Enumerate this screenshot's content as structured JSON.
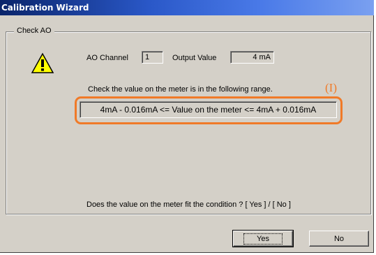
{
  "window": {
    "title": "Calibration Wizard"
  },
  "group": {
    "legend": "Check AO"
  },
  "icons": {
    "warning": "warning-triangle-icon"
  },
  "fields": {
    "ao_channel_label": "AO Channel",
    "ao_channel_value": "1",
    "output_value_label": "Output Value",
    "output_value_value": "4 mA"
  },
  "instruction": "Check the value on the meter is in the following range.",
  "range_text": "4mA - 0.016mA <=  Value on the meter  <= 4mA + 0.016mA",
  "annotation": {
    "marker": "(I)",
    "color": "#f07a28"
  },
  "question": "Does the value on the meter fit the condition ?  [ Yes ] / [ No ]",
  "buttons": {
    "yes": "Yes",
    "no": "No"
  }
}
